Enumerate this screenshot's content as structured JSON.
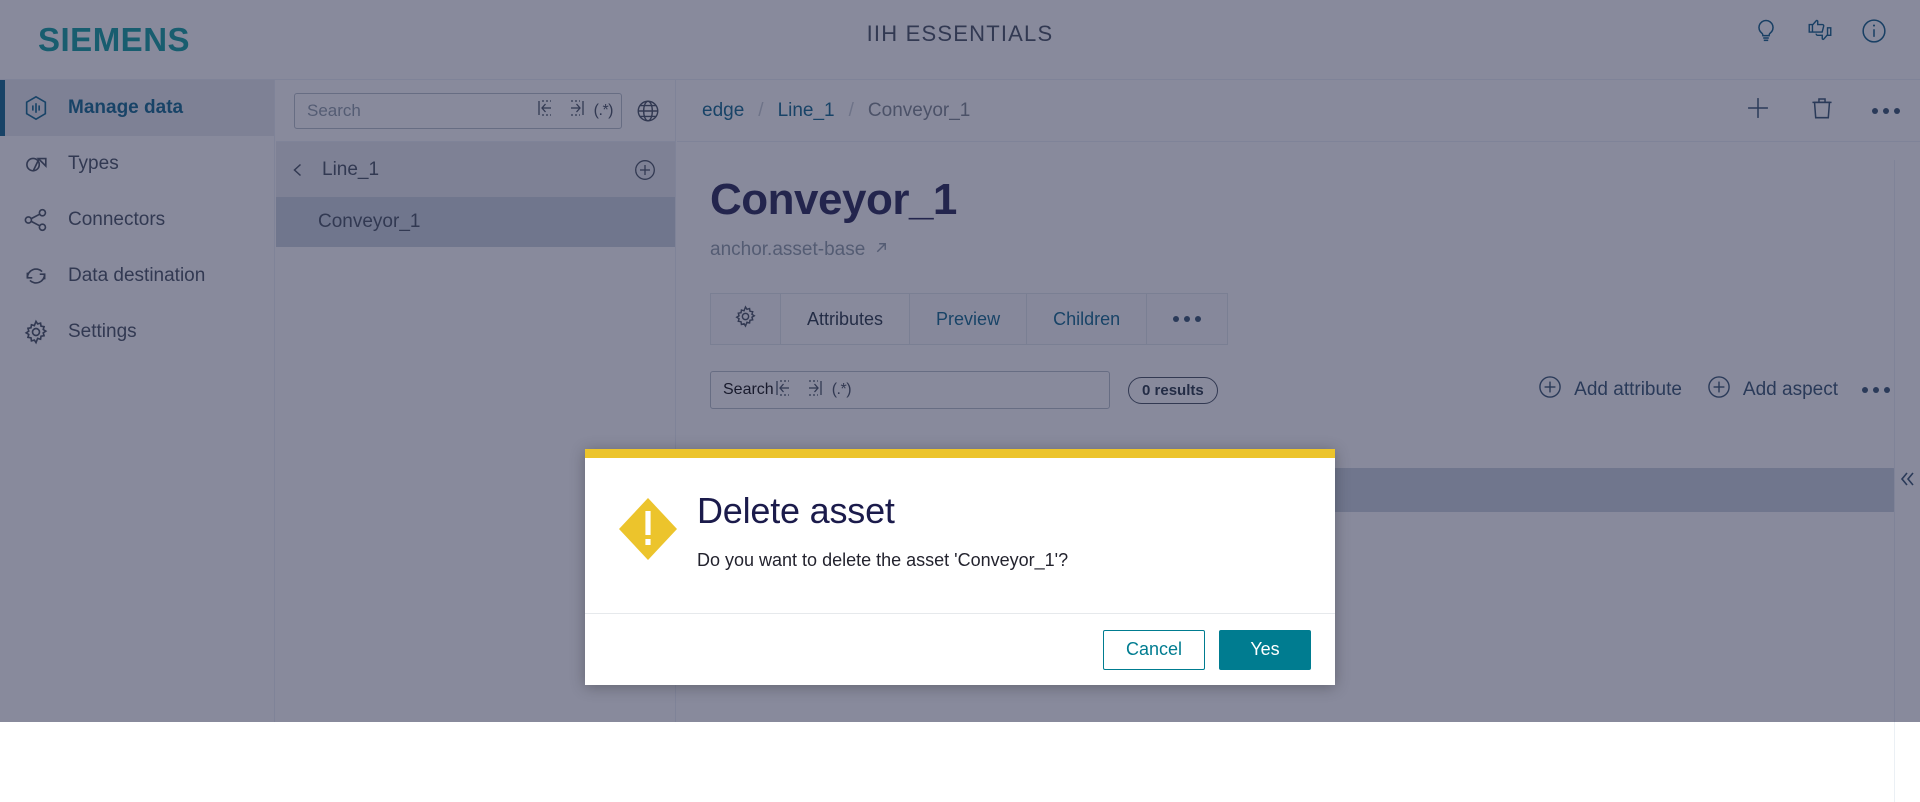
{
  "header": {
    "brand": "SIEMENS",
    "title": "IIH ESSENTIALS",
    "icons": [
      {
        "name": "lightbulb-icon",
        "label": "Tips"
      },
      {
        "name": "feedback-icon",
        "label": "Feedback"
      },
      {
        "name": "info-icon",
        "label": "Info"
      }
    ]
  },
  "sidebar": {
    "items": [
      {
        "label": "Manage data",
        "icon": "manage-data-icon",
        "active": true
      },
      {
        "label": "Types",
        "icon": "types-icon",
        "active": false
      },
      {
        "label": "Connectors",
        "icon": "connectors-icon",
        "active": false
      },
      {
        "label": "Data destination",
        "icon": "data-destination-icon",
        "active": false
      },
      {
        "label": "Settings",
        "icon": "settings-icon",
        "active": false
      }
    ]
  },
  "tree": {
    "search": {
      "placeholder": "Search",
      "value": ""
    },
    "header_label": "Line_1",
    "items": [
      {
        "label": "Conveyor_1",
        "selected": true
      }
    ]
  },
  "breadcrumb": {
    "items": [
      "edge",
      "Line_1",
      "Conveyor_1"
    ],
    "separator": "/"
  },
  "content": {
    "title": "Conveyor_1",
    "subtitle": "anchor.asset-base",
    "tabs": [
      {
        "label": "",
        "icon": "gear-icon",
        "active": false
      },
      {
        "label": "Attributes",
        "active": true
      },
      {
        "label": "Preview",
        "active": false
      },
      {
        "label": "Children",
        "active": false
      },
      {
        "label": "",
        "icon": "more-icon",
        "active": false
      }
    ],
    "attribute_search": {
      "placeholder": "Search",
      "value": ""
    },
    "results_badge": "0 results",
    "add_attribute_label": "Add attribute",
    "add_aspect_label": "Add aspect"
  },
  "dialog": {
    "title": "Delete asset",
    "message": "Do you want to delete the asset 'Conveyor_1'?",
    "cancel_label": "Cancel",
    "confirm_label": "Yes",
    "accent_color": "#ecc42c",
    "confirm_color": "#007c90",
    "icon": "warning-icon"
  },
  "colors": {
    "brand": "#009999",
    "link": "#005f87",
    "warning": "#ecc42c",
    "primary_action": "#007c90"
  }
}
